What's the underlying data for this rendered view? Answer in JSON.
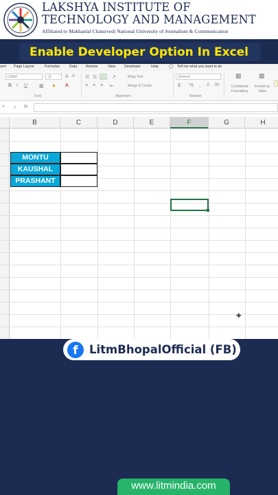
{
  "header": {
    "title": "LAKSHYA INSTITUTE OF TECHNOLOGY AND MANAGEMENT",
    "subtitle": "Affiliated to Makhanlal Chaturvedi National University of Journalism & Communication",
    "logo_color": "#1c2b52"
  },
  "banner": {
    "text": "Enable Developer Option In Excel",
    "color": "#ffe600"
  },
  "excel": {
    "menu": [
      "sert",
      "Page Layout",
      "Formulas",
      "Data",
      "Review",
      "View",
      "Developer",
      "Help",
      "Tell me what you want to do"
    ],
    "ribbon": {
      "font_name": "Calibri",
      "font_size": "11",
      "wrap_text": "Wrap Text",
      "merge_center": "Merge & Center",
      "number_format": "General",
      "conditional_formatting": "Conditional Formatting",
      "format_as_table": "Format as Table",
      "group_font": "Font",
      "group_alignment": "Alignment",
      "group_number": "Number"
    },
    "formula_bar": {
      "cancel": "×",
      "enter": "✓",
      "fx": "fx",
      "value": ""
    },
    "columns": [
      "B",
      "C",
      "D",
      "E",
      "F",
      "G",
      "H"
    ],
    "selected_column": "F",
    "names": [
      "MONTU",
      "KAUSHAL",
      "PRASHANT"
    ],
    "name_fill_color": "#0aa7d9",
    "active_border_color": "#217346"
  },
  "social": {
    "facebook": "LitmBhopalOfficial (FB)",
    "fb_icon": "f"
  },
  "footer": {
    "website": "www.litmindia.com",
    "color": "#27b36a"
  }
}
